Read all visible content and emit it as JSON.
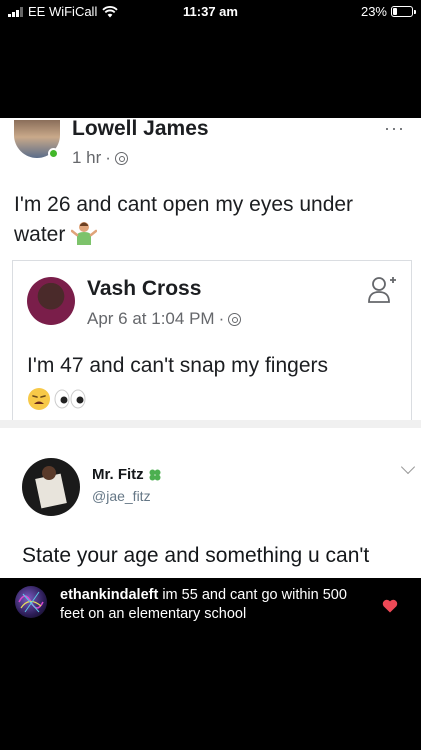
{
  "status_bar": {
    "carrier": "EE WiFiCall",
    "time": "11:37 am",
    "battery": "23%",
    "battery_level": 0.23
  },
  "post": {
    "author": "Lowell James",
    "time": "1 hr",
    "separator": "·",
    "more": "···",
    "text_line1": "I'm 26 and cant open my eyes under",
    "text_line2": "water",
    "emoji": "person-shrugging"
  },
  "shared_post": {
    "author": "Vash Cross",
    "time": "Apr 6 at 1:04 PM",
    "separator": "·",
    "text": "I'm 47 and can't snap my fingers",
    "emojis": [
      "weary-face",
      "eyes"
    ]
  },
  "tweet": {
    "name": "Mr. Fitz",
    "name_emoji": "four-leaf-clover",
    "handle": "@jae_fitz",
    "text": "State your age and something u can't"
  },
  "comment": {
    "username": "ethankindaleft",
    "text": "im 55 and cant go within 500 feet on an elementary school",
    "liked": true,
    "heart_color": "#ed4956"
  },
  "colors": {
    "online": "#42b72a",
    "meta_gray": "#65676b",
    "twitter_gray": "#657786"
  }
}
